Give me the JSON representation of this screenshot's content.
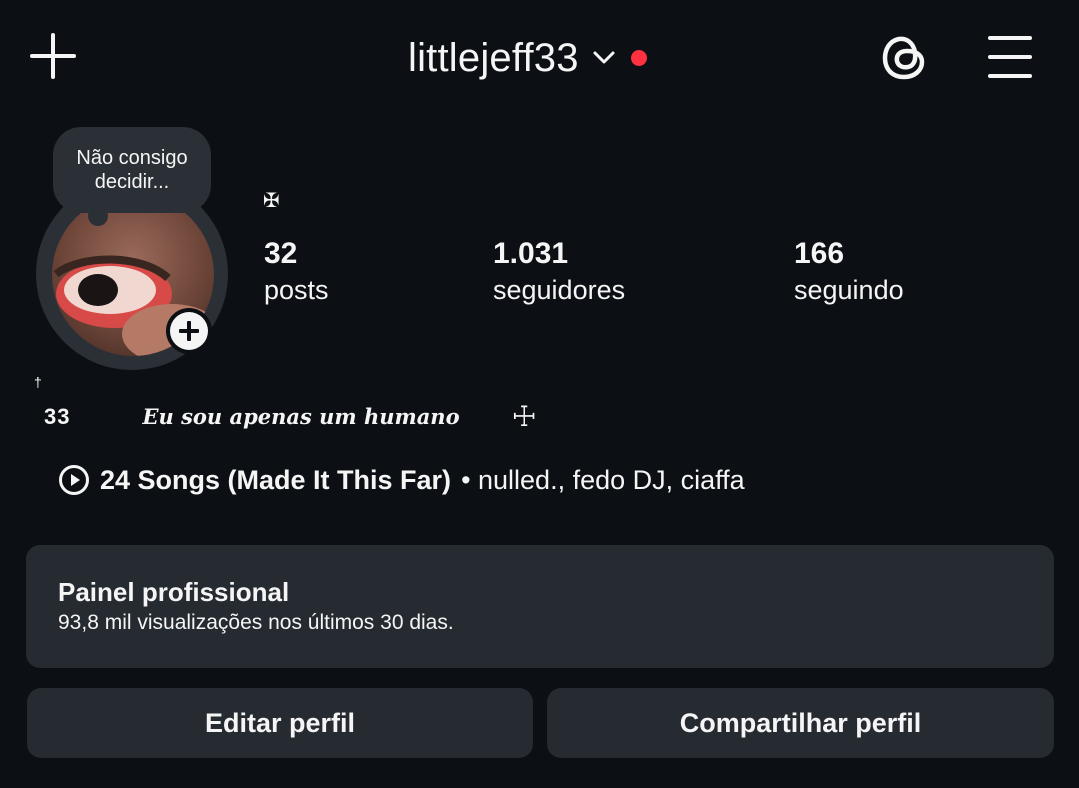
{
  "header": {
    "username": "littlejeff33",
    "icons": [
      "plus-icon",
      "chevron-down-icon",
      "notification-dot",
      "threads-icon",
      "menu-icon"
    ],
    "accent_color": "#ff3040"
  },
  "profile": {
    "note": "Não consigo decidir...",
    "stats": [
      {
        "value": "32",
        "label": "posts"
      },
      {
        "value": "1.031",
        "label": "seguidores"
      },
      {
        "value": "166",
        "label": "seguindo"
      }
    ],
    "name_symbol": "✠"
  },
  "bio": {
    "dagger": "†",
    "number": "33",
    "text": "Eu sou apenas um humano",
    "cross": "☩"
  },
  "music": {
    "title": "24 Songs (Made It This Far)",
    "artists": "• nulled., fedo DJ, ciaffa"
  },
  "dashboard": {
    "title": "Painel profissional",
    "subtitle": "93,8 mil visualizações nos últimos 30 dias."
  },
  "buttons": {
    "edit": "Editar perfil",
    "share": "Compartilhar perfil"
  }
}
